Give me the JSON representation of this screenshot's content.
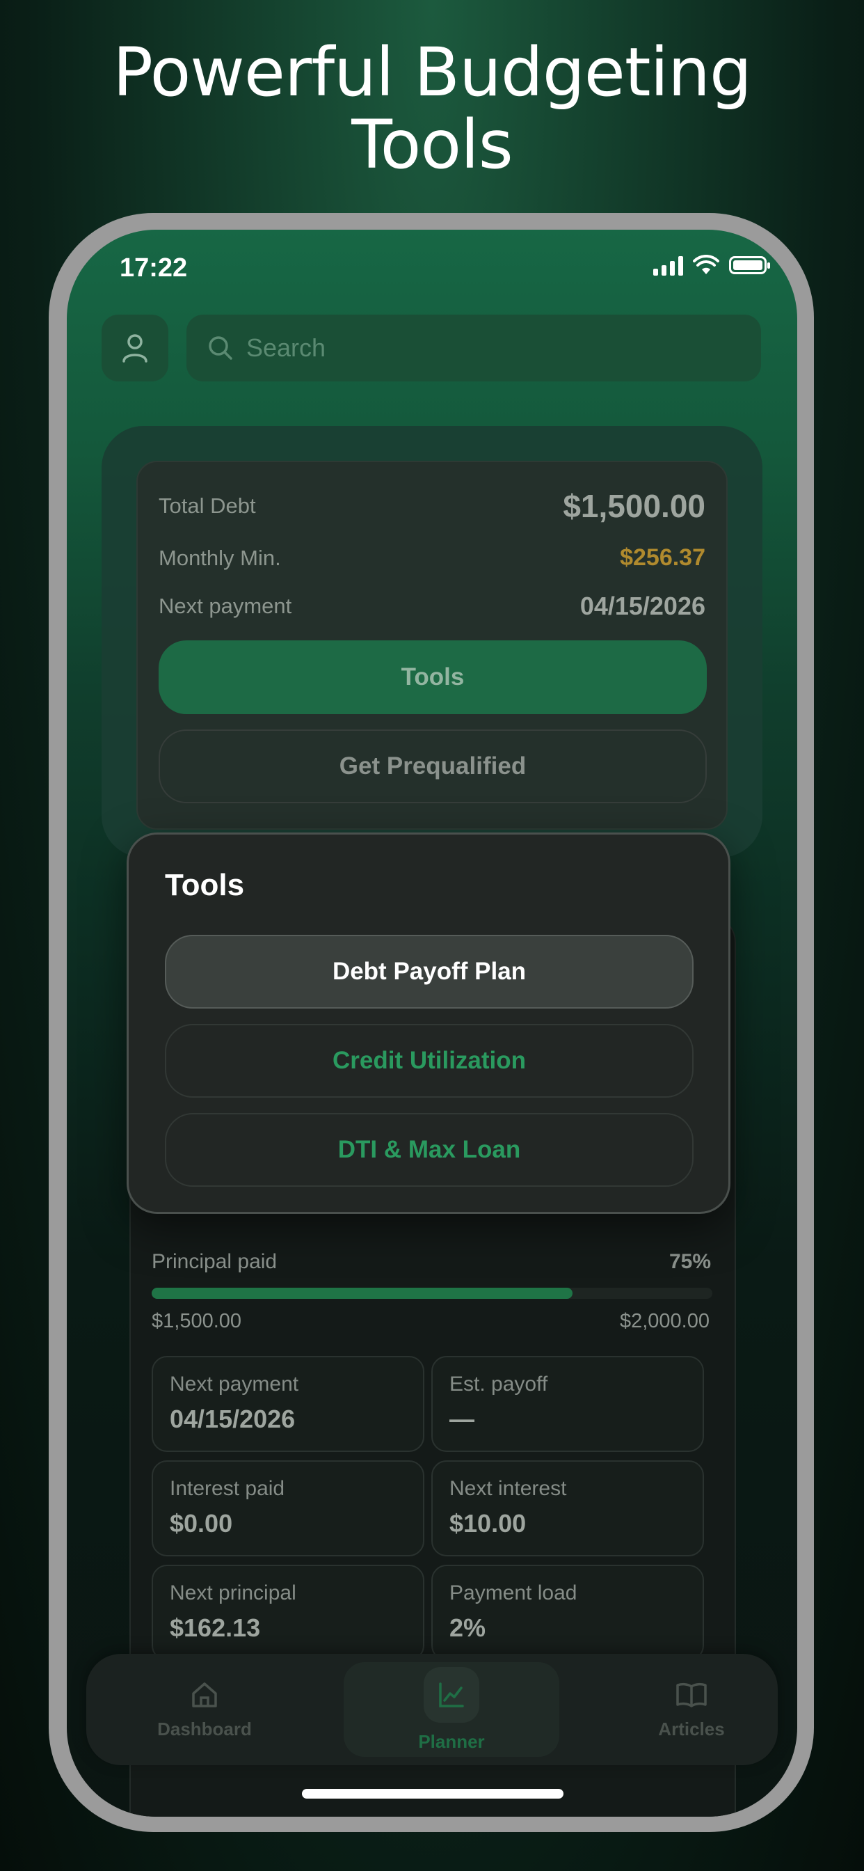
{
  "headline": {
    "line1": "Powerful Budgeting",
    "line2": "Tools"
  },
  "status_bar": {
    "time": "17:22"
  },
  "search": {
    "placeholder": "Search"
  },
  "summary": {
    "total_debt_label": "Total Debt",
    "total_debt_value": "$1,500.00",
    "monthly_min_label": "Monthly Min.",
    "monthly_min_value": "$256.37",
    "next_payment_label": "Next payment",
    "next_payment_value": "04/15/2026",
    "tools_button": "Tools",
    "prequal_button": "Get Prequalified",
    "colors": {
      "monthly_min": "#b08a2e",
      "accent": "#1d6a45"
    }
  },
  "tools_popup": {
    "title": "Tools",
    "items": [
      "Debt Payoff Plan",
      "Credit Utilization",
      "DTI & Max Loan"
    ]
  },
  "detail": {
    "principal_label": "Principal paid",
    "principal_pct": "75%",
    "principal_fraction": 0.75,
    "progress_min": "$1,500.00",
    "progress_max": "$2,000.00",
    "stats": [
      {
        "label": "Next payment",
        "value": "04/15/2026"
      },
      {
        "label": "Est. payoff",
        "value": "—"
      },
      {
        "label": "Interest paid",
        "value": "$0.00"
      },
      {
        "label": "Next interest",
        "value": "$10.00"
      },
      {
        "label": "Next principal",
        "value": "$162.13"
      },
      {
        "label": "Payment load",
        "value": "2%"
      }
    ]
  },
  "tabbar": {
    "items": [
      {
        "label": "Dashboard",
        "icon": "home-icon"
      },
      {
        "label": "Planner",
        "icon": "chart-icon"
      },
      {
        "label": "Articles",
        "icon": "book-icon"
      }
    ],
    "active": "Planner"
  }
}
